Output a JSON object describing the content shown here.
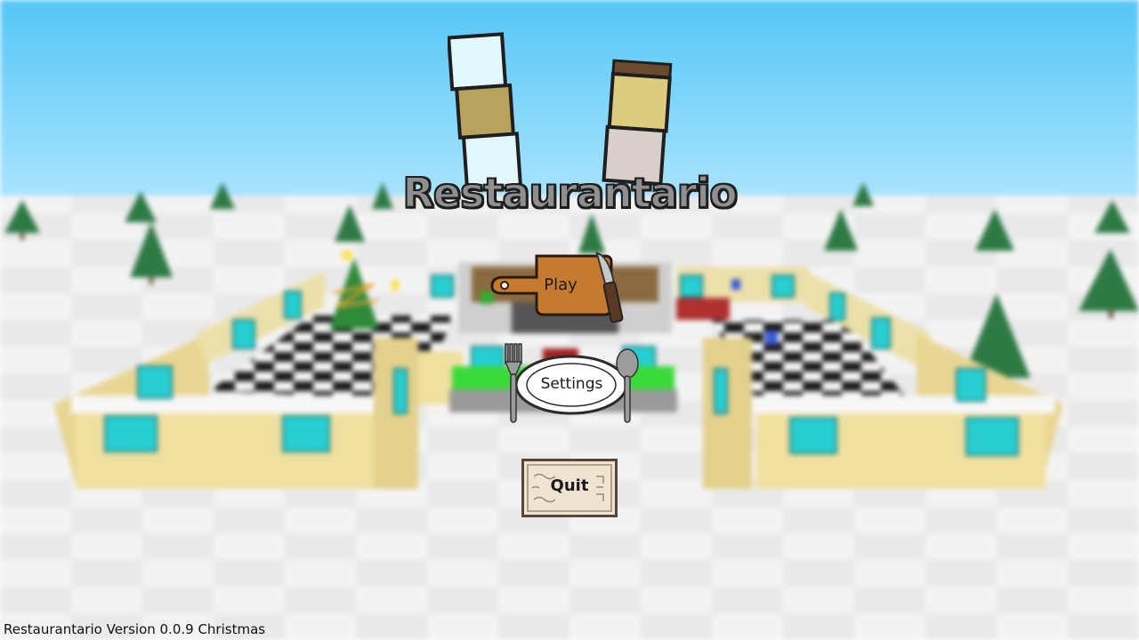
{
  "game": {
    "title": "Restaurantario",
    "version_text": "Restaurantario Version 0.0.9 Christmas"
  },
  "menu": {
    "play_label": "Play",
    "settings_label": "Settings",
    "quit_label": "Quit"
  },
  "icons": {
    "play": "cutting-board-icon",
    "knife": "knife-icon",
    "settings": "dinner-plate-icon",
    "fork": "fork-icon",
    "spoon": "spoon-icon",
    "quit": "menu-card-icon"
  },
  "colors": {
    "sky_top": "#52c4f4",
    "sky_bottom": "#a8e4ff",
    "snow": "#f4f4f4",
    "wall": "#f0e0a0",
    "window": "#2bd6d6",
    "board": "#c57a2e",
    "title_fill": "#8f8f8f",
    "title_outline": "#1e1e1e"
  }
}
